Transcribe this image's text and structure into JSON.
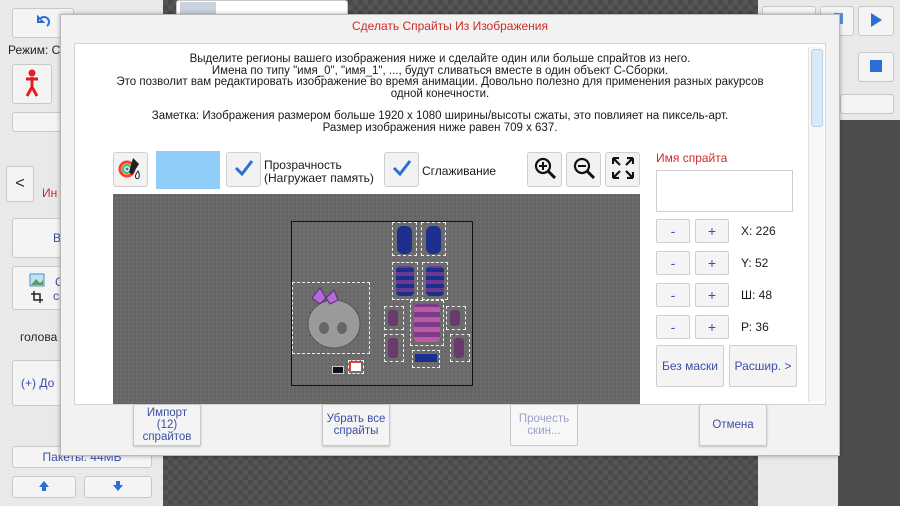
{
  "background": {
    "mode_label": "Режим: С",
    "left_button_partial_1": "Ин",
    "left_button_partial_2": "В",
    "left_import_partial_1": "С",
    "left_import_partial_2": "сп",
    "left_head_label": "голова",
    "left_add_label": "(+) До",
    "pack_label": "Пакеты: 44MБ",
    "back_arrow": "<"
  },
  "dialog": {
    "title": "Сделать Спрайты Из Изображения",
    "info_lines_1": [
      "Выделите регионы вашего изображения ниже и сделайте один или больше спрайтов из него.",
      "Имена по типу \"имя_0\", \"имя_1\", ...,  будут сливаться вместе в один объект С-Сборки.",
      "Это позволит вам редактировать изображение во время анимации. Довольно полезно для применения разных ракурсов",
      "одной конечности."
    ],
    "info_lines_2": [
      "Заметка: Изображения размером больше 1920 x 1080 ширины/высоты сжаты, это повлияет на пиксель-арт.",
      "Размер изображения ниже равен 709 x 637."
    ],
    "transparency_label_1": "Прозрачность",
    "transparency_label_2": "(Нагружает память)",
    "smoothing_label": "Сглаживание",
    "swatch_color": "#8ecdf8",
    "sprite_name_title": "Имя спрайта",
    "sprite_name_value": "",
    "minus": "-",
    "plus": "+",
    "coords": {
      "x": "X: 226",
      "y": "Y: 52",
      "w": "Ш: 48",
      "r": "Р: 36"
    },
    "no_mask_label": "Без маски",
    "advanced_label": "Расшир. >",
    "import_label_1": "Импорт",
    "import_label_2": "(12)",
    "import_label_3": "спрайтов",
    "remove_all_label_1": "Убрать все",
    "remove_all_label_2": "спрайты",
    "read_skin_label_1": "Прочесть",
    "read_skin_label_2": "скин...",
    "cancel_label": "Отмена"
  },
  "colors": {
    "title_red": "#d02a2a",
    "button_text_blue": "#3a4fa8",
    "accent_blue": "#2a6fd6"
  },
  "icons": {
    "color_picker": "color-picker-icon",
    "check": "check-icon",
    "zoom_in": "zoom-in-icon",
    "zoom_out": "zoom-out-icon",
    "fit": "fit-screen-icon"
  }
}
